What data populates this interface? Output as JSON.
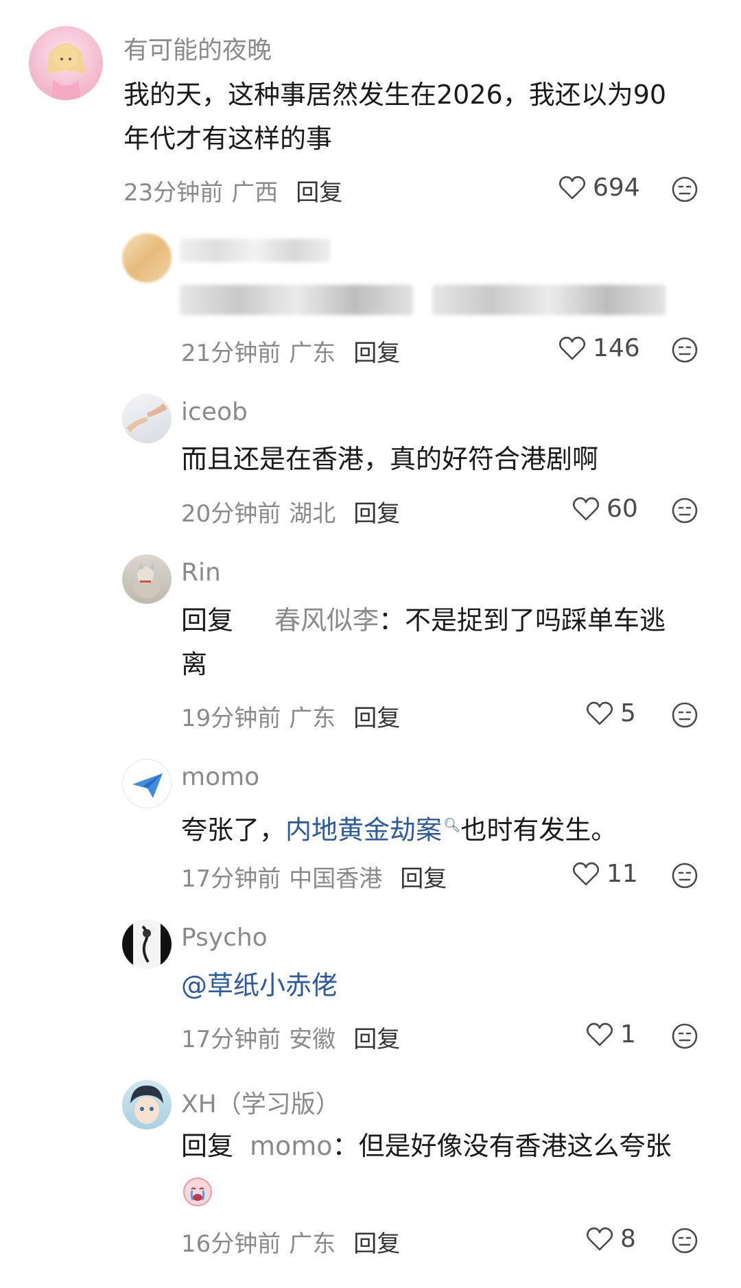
{
  "comments": [
    {
      "username": "有可能的夜晚",
      "lines": [
        "我的天，这种事居然发生在2026，我还以为90",
        "年代才有这样的事"
      ],
      "time": "23分钟前",
      "location": "广西",
      "reply_label": "回复",
      "likes": "694"
    },
    {
      "username": "春风似李",
      "time": "21分钟前",
      "location": "广东",
      "reply_label": "回复",
      "likes": "146"
    },
    {
      "username": "iceob",
      "lines": [
        "而且还是在香港，真的好符合港剧啊"
      ],
      "time": "20分钟前",
      "location": "湖北",
      "reply_label": "回复",
      "likes": "60"
    },
    {
      "username": "Rin",
      "reply_prefix": "回复",
      "reply_to": "春风似李",
      "reply_text": "：不是捉到了吗踩单车逃",
      "line2": "离",
      "time": "19分钟前",
      "location": "广东",
      "reply_label": "回复",
      "likes": "5"
    },
    {
      "username": "momo",
      "text_before": "夸张了，",
      "link": "内地黄金劫案",
      "text_after": "也时有发生。",
      "time": "17分钟前",
      "location": "中国香港",
      "reply_label": "回复",
      "likes": "11"
    },
    {
      "username": "Psycho",
      "mention": "@草纸小赤佬",
      "time": "17分钟前",
      "location": "安徽",
      "reply_label": "回复",
      "likes": "1"
    },
    {
      "username": "XH（学习版）",
      "reply_prefix": "回复",
      "reply_to": "momo",
      "reply_text": "：但是好像没有香港这么夸张",
      "time": "16分钟前",
      "location": "广东",
      "reply_label": "回复",
      "likes": "8"
    }
  ],
  "icons": {
    "like": "heart-outline-icon",
    "emoji": "neutral-face-icon",
    "search_hint": "search-icon",
    "crying_emoji": "crying-face-emoji"
  },
  "colors": {
    "link": "#2c5aa0",
    "meta": "#8a8a8a",
    "text": "#1a1a1a"
  }
}
